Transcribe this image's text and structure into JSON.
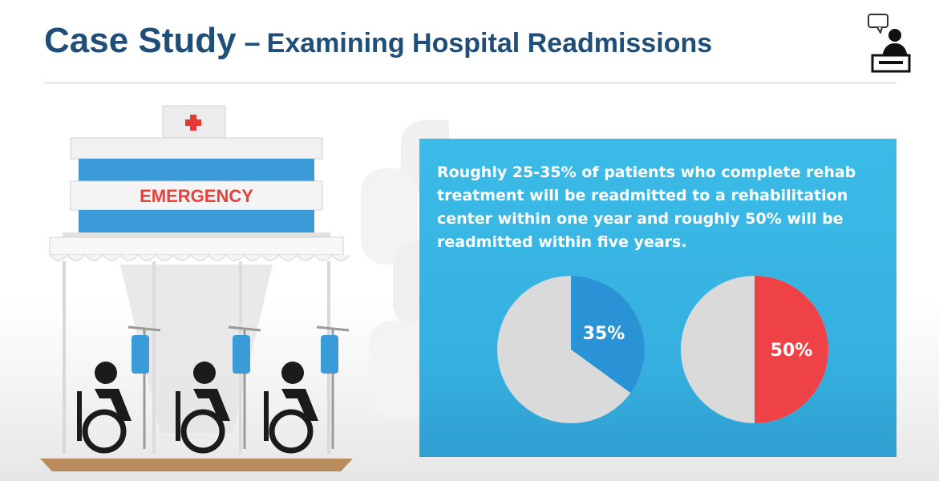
{
  "header": {
    "title_main": "Case Study",
    "title_dash": "–",
    "title_sub": "Examining Hospital Readmissions"
  },
  "illustration": {
    "sign_text": "EMERGENCY",
    "colors": {
      "stripe": "#3b9bd9",
      "sign_text": "#e8413b",
      "cross": "#e53935",
      "base": "#b98c5e"
    }
  },
  "info_panel": {
    "text": "Roughly 25-35% of patients who complete rehab treatment will be readmitted to a rehabilitation center within one year and roughly 50% will be readmitted within five years."
  },
  "chart_data": {
    "type": "pie",
    "charts": [
      {
        "value_label": "35%",
        "fraction": 0.35,
        "color": "#2a93d5",
        "rest_color": "#dadada"
      },
      {
        "value_label": "50%",
        "fraction": 0.5,
        "color": "#ef4246",
        "rest_color": "#dadada"
      }
    ]
  },
  "colors": {
    "title": "#1f4e79",
    "panel": "#3bbbe8"
  }
}
